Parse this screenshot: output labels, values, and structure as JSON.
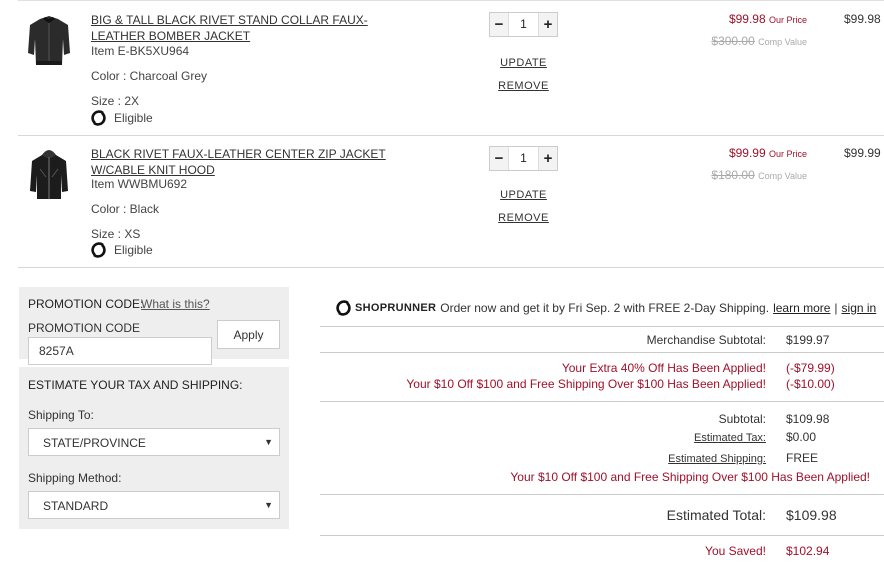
{
  "items": [
    {
      "name": "BIG & TALL BLACK RIVET STAND COLLAR FAUX-LEATHER BOMBER JACKET",
      "item_no": "Item E-BK5XU964",
      "color": "Color : Charcoal Grey",
      "size": "Size : 2X",
      "eligible": "Eligible",
      "qty": "1",
      "update": "UPDATE",
      "remove": "REMOVE",
      "our_price": "$99.98",
      "our_price_label": "Our Price",
      "comp_price": "$300.00",
      "comp_label": "Comp Value",
      "line_total": "$99.98"
    },
    {
      "name": "BLACK RIVET FAUX-LEATHER CENTER ZIP JACKET W/CABLE KNIT HOOD",
      "item_no": "Item WWBMU692",
      "color": "Color : Black",
      "size": "Size : XS",
      "eligible": "Eligible",
      "qty": "1",
      "update": "UPDATE",
      "remove": "REMOVE",
      "our_price": "$99.99",
      "our_price_label": "Our Price",
      "comp_price": "$180.00",
      "comp_label": "Comp Value",
      "line_total": "$99.99"
    }
  ],
  "promo": {
    "title": "PROMOTION CODE:",
    "what_link": "What is this?",
    "field_label": "PROMOTION CODE",
    "value": "8257A",
    "apply": "Apply"
  },
  "tax": {
    "title": "ESTIMATE YOUR TAX AND SHIPPING:",
    "ship_to_label": "Shipping To:",
    "ship_to_value": "STATE/PROVINCE",
    "method_label": "Shipping Method:",
    "method_value": "STANDARD"
  },
  "shoprunner": {
    "brand": "SHOPRUNNER",
    "message": "Order now and get it by Fri Sep. 2 with FREE 2-Day Shipping.",
    "learn_more": "learn more",
    "separator": "|",
    "sign_in": "sign in"
  },
  "summary": {
    "merch_label": "Merchandise Subtotal:",
    "merch_value": "$199.97",
    "discount1_label": "Your Extra 40% Off Has Been Applied!",
    "discount1_value": "(-$79.99)",
    "discount2_label": "Your $10 Off $100 and Free Shipping Over $100 Has Been Applied!",
    "discount2_value": "(-$10.00)",
    "subtotal_label": "Subtotal:",
    "subtotal_value": "$109.98",
    "tax_label": "Estimated Tax:",
    "tax_value": "$0.00",
    "shipping_label": "Estimated Shipping:",
    "shipping_value": "FREE",
    "shipping_note": "Your $10 Off $100 and Free Shipping Over $100 Has Been Applied!",
    "total_label": "Estimated Total:",
    "total_value": "$109.98",
    "saved_label": "You Saved!",
    "saved_value": "$102.94"
  },
  "colors": {
    "accent_red": "#a0112a"
  }
}
